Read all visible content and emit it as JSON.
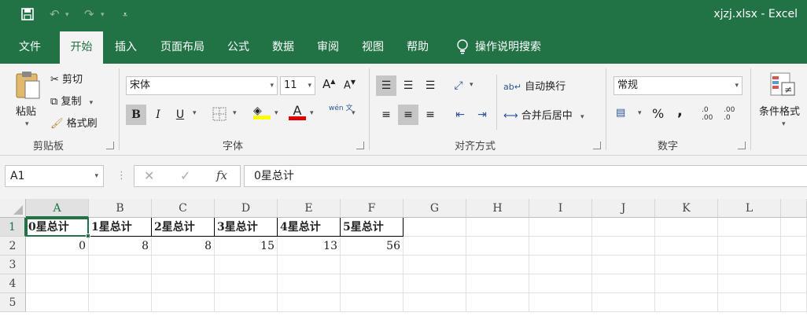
{
  "window": {
    "title": "xjzj.xlsx  -  Excel"
  },
  "quick_access": {
    "save_icon": "save-icon",
    "undo_icon": "undo-icon",
    "redo_icon": "redo-icon",
    "customize_icon": "customize-icon"
  },
  "menu": {
    "items": [
      "文件",
      "开始",
      "插入",
      "页面布局",
      "公式",
      "数据",
      "审阅",
      "视图",
      "帮助"
    ],
    "active": "开始",
    "tell_me": "操作说明搜索"
  },
  "ribbon": {
    "clipboard": {
      "paste": "粘贴",
      "cut": "剪切",
      "copy": "复制",
      "format_painter": "格式刷",
      "label": "剪贴板"
    },
    "font": {
      "name": "宋体",
      "size": "11",
      "bold": "B",
      "italic": "I",
      "underline": "U",
      "grow": "A",
      "shrink": "A",
      "font_color_letter": "A",
      "wen": "wén 文",
      "label": "字体"
    },
    "alignment": {
      "wrap": "自动换行",
      "merge": "合并后居中",
      "label": "对齐方式"
    },
    "number": {
      "format": "常规",
      "percent": "%",
      "comma": ",",
      "inc_decimal": ".0\n.00",
      "dec_decimal": ".00\n.0",
      "label": "数字"
    },
    "styles": {
      "conditional": "条件格式"
    }
  },
  "formula_bar": {
    "name_box": "A1",
    "fx": "fx",
    "cancel": "✕",
    "enter": "✓",
    "content": "0星总计"
  },
  "sheet": {
    "columns": [
      "A",
      "B",
      "C",
      "D",
      "E",
      "F",
      "G",
      "H",
      "I",
      "J",
      "K",
      "L"
    ],
    "rows": [
      "1",
      "2",
      "3",
      "4",
      "5"
    ],
    "selected_cell": "A1",
    "row1": [
      "0星总计",
      "1星总计",
      "2星总计",
      "3星总计",
      "4星总计",
      "5星总计"
    ],
    "row2": [
      "0",
      "8",
      "8",
      "15",
      "13",
      "56"
    ]
  },
  "colors": {
    "brand": "#217346",
    "ribbon_bg": "#f3f3f3"
  }
}
